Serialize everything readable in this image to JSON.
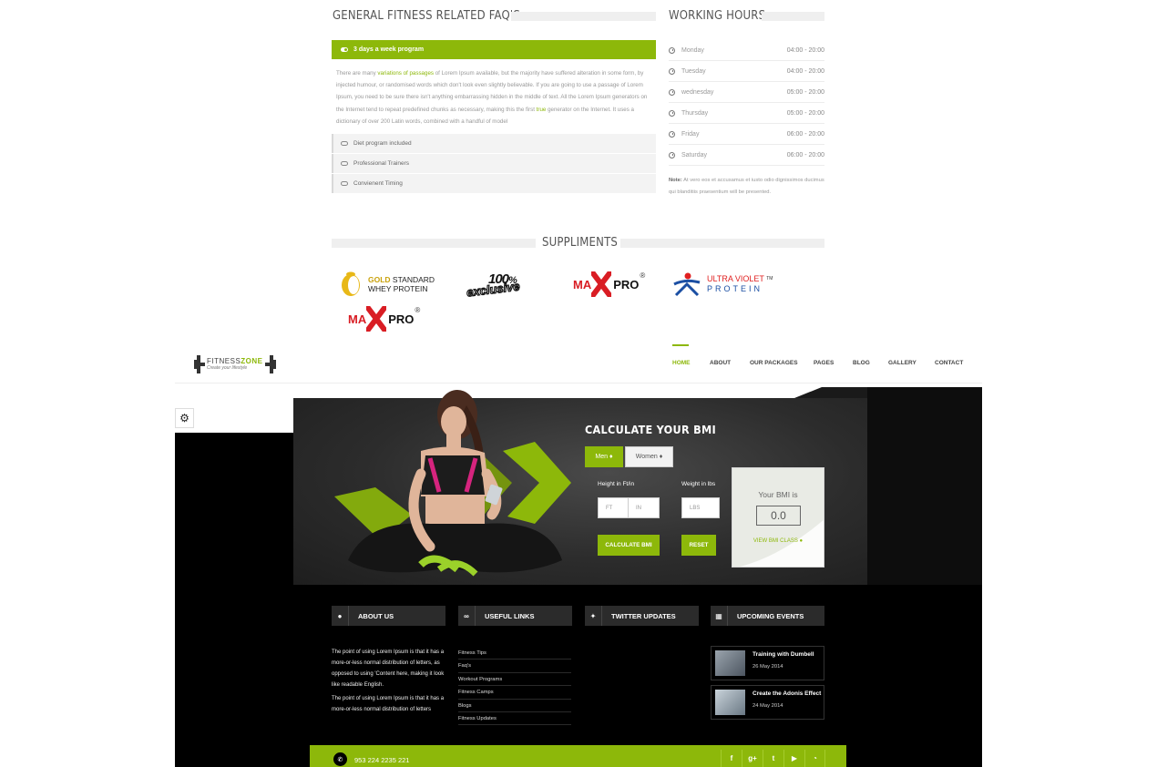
{
  "faq": {
    "title": "GENERAL FITNESS RELATED FAQ'S",
    "active": {
      "label": "3 days a week program"
    },
    "body_part1": "There are many ",
    "body_link1": "variations of passages",
    "body_part2": " of Lorem Ipsum available, but the majority have suffered alteration in some form, by injected humour, or randomised words which don't look even slightly believable. If you are going to use a passage of Lorem Ipsum, you need to be sure there isn't anything embarrassing hidden in the middle of text. All the Lorem Ipsum generators on the Internet tend to repeat predefined chunks as necessary, making this the first ",
    "body_link2": "true",
    "body_part3": " generator on the Internet. It uses a dictionary of over 200 Latin words, combined with a handful of model",
    "items": [
      {
        "label": "Diet program included"
      },
      {
        "label": "Professional Trainers"
      },
      {
        "label": "Convienent Timing"
      }
    ]
  },
  "hours": {
    "title": "WORKING HOURS",
    "rows": [
      {
        "day": "Monday",
        "time": "04:00 - 20:00"
      },
      {
        "day": "Tuesday",
        "time": "04:00 - 20:00"
      },
      {
        "day": "wednesday",
        "time": "05:00 - 20:00"
      },
      {
        "day": "Thursday",
        "time": "05:00 - 20:00"
      },
      {
        "day": "Friday",
        "time": "06:00 - 20:00"
      },
      {
        "day": "Saturday",
        "time": "06:00 - 20:00"
      }
    ],
    "note_label": "Note:",
    "note_text": " At vero eos et accusamus et iusto odio dignissimos ducimus qui blanditiis praesentium will be presented."
  },
  "suppliments": {
    "title": "SUPPLIMENTS",
    "logos": [
      {
        "line1a": "GOLD",
        "line1b": " STANDARD",
        "line2": "WHEY PROTEIN"
      },
      {
        "text1": "100",
        "text2": "%",
        "text3": "exclusive"
      },
      {
        "text_a": "MA",
        "text_b": "PRO",
        "reg": "®"
      },
      {
        "text_a": "ULTRA",
        "text_b": " VIOLET",
        "tm": "TM",
        "line2": "PROTEIN"
      },
      {
        "text_a": "MA",
        "text_b": "PRO",
        "reg": "®"
      }
    ]
  },
  "brand": {
    "name_a": "FITNESS",
    "name_b": "ZONE",
    "tagline": "Create your lifestyle"
  },
  "nav": {
    "items": [
      {
        "label": "HOME"
      },
      {
        "label": "ABOUT"
      },
      {
        "label": "OUR PACKAGES"
      },
      {
        "label": "PAGES"
      },
      {
        "label": "BLOG"
      },
      {
        "label": "GALLERY"
      },
      {
        "label": "CONTACT"
      }
    ]
  },
  "bmi": {
    "title": "CALCULATE YOUR BMI",
    "tab_men": "Men",
    "tab_women": "Women",
    "height_label": "Height in Ft/in",
    "weight_label": "Weight in lbs",
    "ft_placeholder": "FT",
    "in_placeholder": "IN",
    "lbs_placeholder": "LBS",
    "calc_label": "CALCULATE BMI",
    "reset_label": "RESET",
    "result_label": "Your BMI is",
    "result_value": "0.0",
    "view_class": "VIEW BMI CLASS"
  },
  "footer": {
    "about_title": "ABOUT US",
    "links_title": "USEFUL LINKS",
    "twitter_title": "TWITTER UPDATES",
    "events_title": "UPCOMING EVENTS",
    "about_p1": "The point of using Lorem Ipsum is that it has a more-or-less normal distribution of letters, as opposed to using 'Content here, making it look like readable English.",
    "about_p2": "The point of using Lorem Ipsum is that it has a more-or-less normal distribution of letters",
    "links": [
      {
        "label": "Fitness Tips"
      },
      {
        "label": "Faq's"
      },
      {
        "label": "Workout Programs"
      },
      {
        "label": "Fitness Camps"
      },
      {
        "label": "Blogs"
      },
      {
        "label": "Fitness Updates"
      }
    ],
    "events": [
      {
        "title": "Training with Dumbell",
        "date": "26 May 2014"
      },
      {
        "title": "Create the Adonis Effect",
        "date": "24 May 2014"
      }
    ],
    "phone": "953 224 2235 221",
    "social": [
      {
        "icon": "facebook-icon",
        "glyph": "f"
      },
      {
        "icon": "google-plus-icon",
        "glyph": "g+"
      },
      {
        "icon": "twitter-icon",
        "glyph": "t"
      },
      {
        "icon": "youtube-icon",
        "glyph": "▶"
      },
      {
        "icon": "rss-icon",
        "glyph": "◔"
      }
    ]
  },
  "colors": {
    "accent": "#8db80a",
    "dark": "#000000"
  }
}
